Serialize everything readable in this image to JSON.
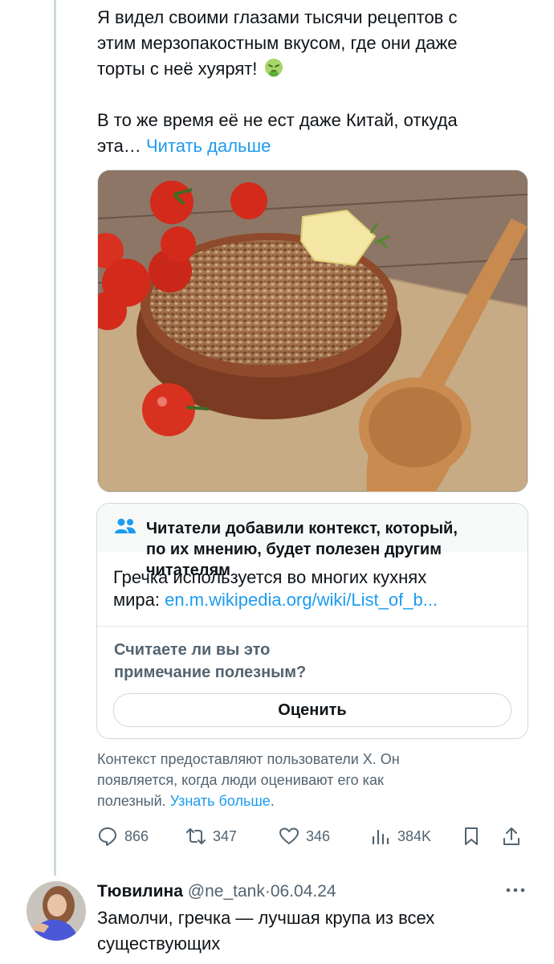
{
  "tweet": {
    "line1": "Я видел своими глазами тысячи рецептов с",
    "line2": "этим мерзопакостным вкусом, где они даже",
    "line3_text": "торты с неё хуярят!",
    "line3_emoji": "nauseated-face-emoji",
    "line4": "В то же время её не ест даже Китай, откуда",
    "line5_text": "эта…",
    "read_more": "Читать дальше"
  },
  "media": {
    "alt_subject": "buckwheat-bowl-photo"
  },
  "community_note": {
    "header_icon": "people-icon",
    "header_line1": "Читатели добавили контекст, который,",
    "header_line2": "по их мнению, будет полезен другим",
    "header_line3": "читателям",
    "body_text": "Гречка используется во многих кухнях",
    "body_text2": "мира:",
    "body_link": "en.m.wikipedia.org/wiki/List_of_b...",
    "question_line1": "Считаете ли вы это",
    "question_line2": "примечание полезным?",
    "rate_button": "Оценить"
  },
  "context_footer": {
    "line1": "Контекст предоставляют пользователи X. Он",
    "line2": "появляется, когда люди оценивают его как",
    "line3": "полезный.",
    "learn_more": "Узнать больше",
    "period": "."
  },
  "actions": {
    "replies": "866",
    "retweets": "347",
    "likes": "346",
    "views": "384K"
  },
  "reply": {
    "name": "Тювилина",
    "handle": "@ne_tank",
    "separator": "·",
    "date": "06.04.24",
    "text_line1": "Замолчи, гречка — лучшая крупа из всех",
    "text_line2": "существующих"
  },
  "colors": {
    "accent": "#1d9bf0",
    "text_primary": "#0f1419",
    "text_secondary": "#536471"
  }
}
